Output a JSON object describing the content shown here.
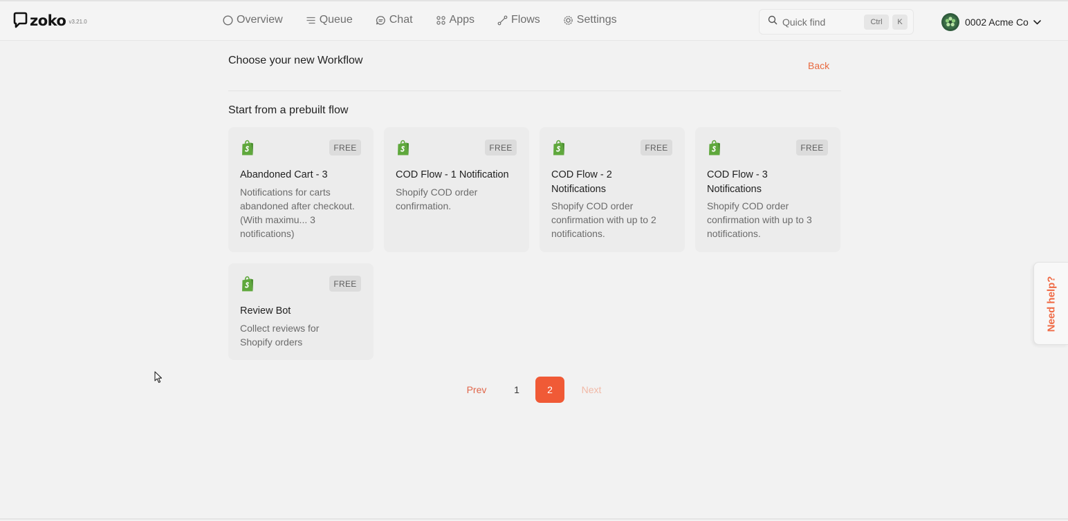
{
  "app": {
    "logo_text": "zoko",
    "version": "v3.21.0"
  },
  "nav": {
    "items": [
      {
        "label": "Overview",
        "icon": "circle-icon"
      },
      {
        "label": "Queue",
        "icon": "queue-lines-icon"
      },
      {
        "label": "Chat",
        "icon": "chat-bubble-icon"
      },
      {
        "label": "Apps",
        "icon": "apps-grid-icon"
      },
      {
        "label": "Flows",
        "icon": "flows-icon"
      },
      {
        "label": "Settings",
        "icon": "gear-icon"
      }
    ]
  },
  "search": {
    "placeholder": "Quick find",
    "shortcut_ctrl": "Ctrl",
    "shortcut_key": "K"
  },
  "account": {
    "name": "0002 Acme Co"
  },
  "page": {
    "heading": "Choose your new Workflow",
    "back_label": "Back",
    "subheading": "Start from a prebuilt flow"
  },
  "cards": [
    {
      "title": "Abandoned Cart - 3",
      "desc": "Notifications for carts abandoned after checkout. (With maximu... 3 notifications)",
      "badge": "FREE",
      "icon": "shopify-bag-icon"
    },
    {
      "title": "COD Flow - 1 Notification",
      "desc": "Shopify COD order confirmation.",
      "badge": "FREE",
      "icon": "shopify-bag-icon"
    },
    {
      "title": "COD Flow - 2 Notifications",
      "desc": "Shopify COD order confirmation with up to 2 notifications.",
      "badge": "FREE",
      "icon": "shopify-bag-icon"
    },
    {
      "title": "COD Flow - 3 Notifications",
      "desc": "Shopify COD order confirmation with up to 3 notifications.",
      "badge": "FREE",
      "icon": "shopify-bag-icon"
    },
    {
      "title": "Review Bot",
      "desc": "Collect reviews for Shopify orders",
      "badge": "FREE",
      "icon": "shopify-bag-icon"
    }
  ],
  "pagination": {
    "prev_label": "Prev",
    "pages": [
      "1",
      "2"
    ],
    "current": "2",
    "next_label": "Next"
  },
  "help_tab": {
    "label": "Need help?"
  },
  "colors": {
    "accent": "#f05a36",
    "shopify_green": "#5fa83c"
  }
}
